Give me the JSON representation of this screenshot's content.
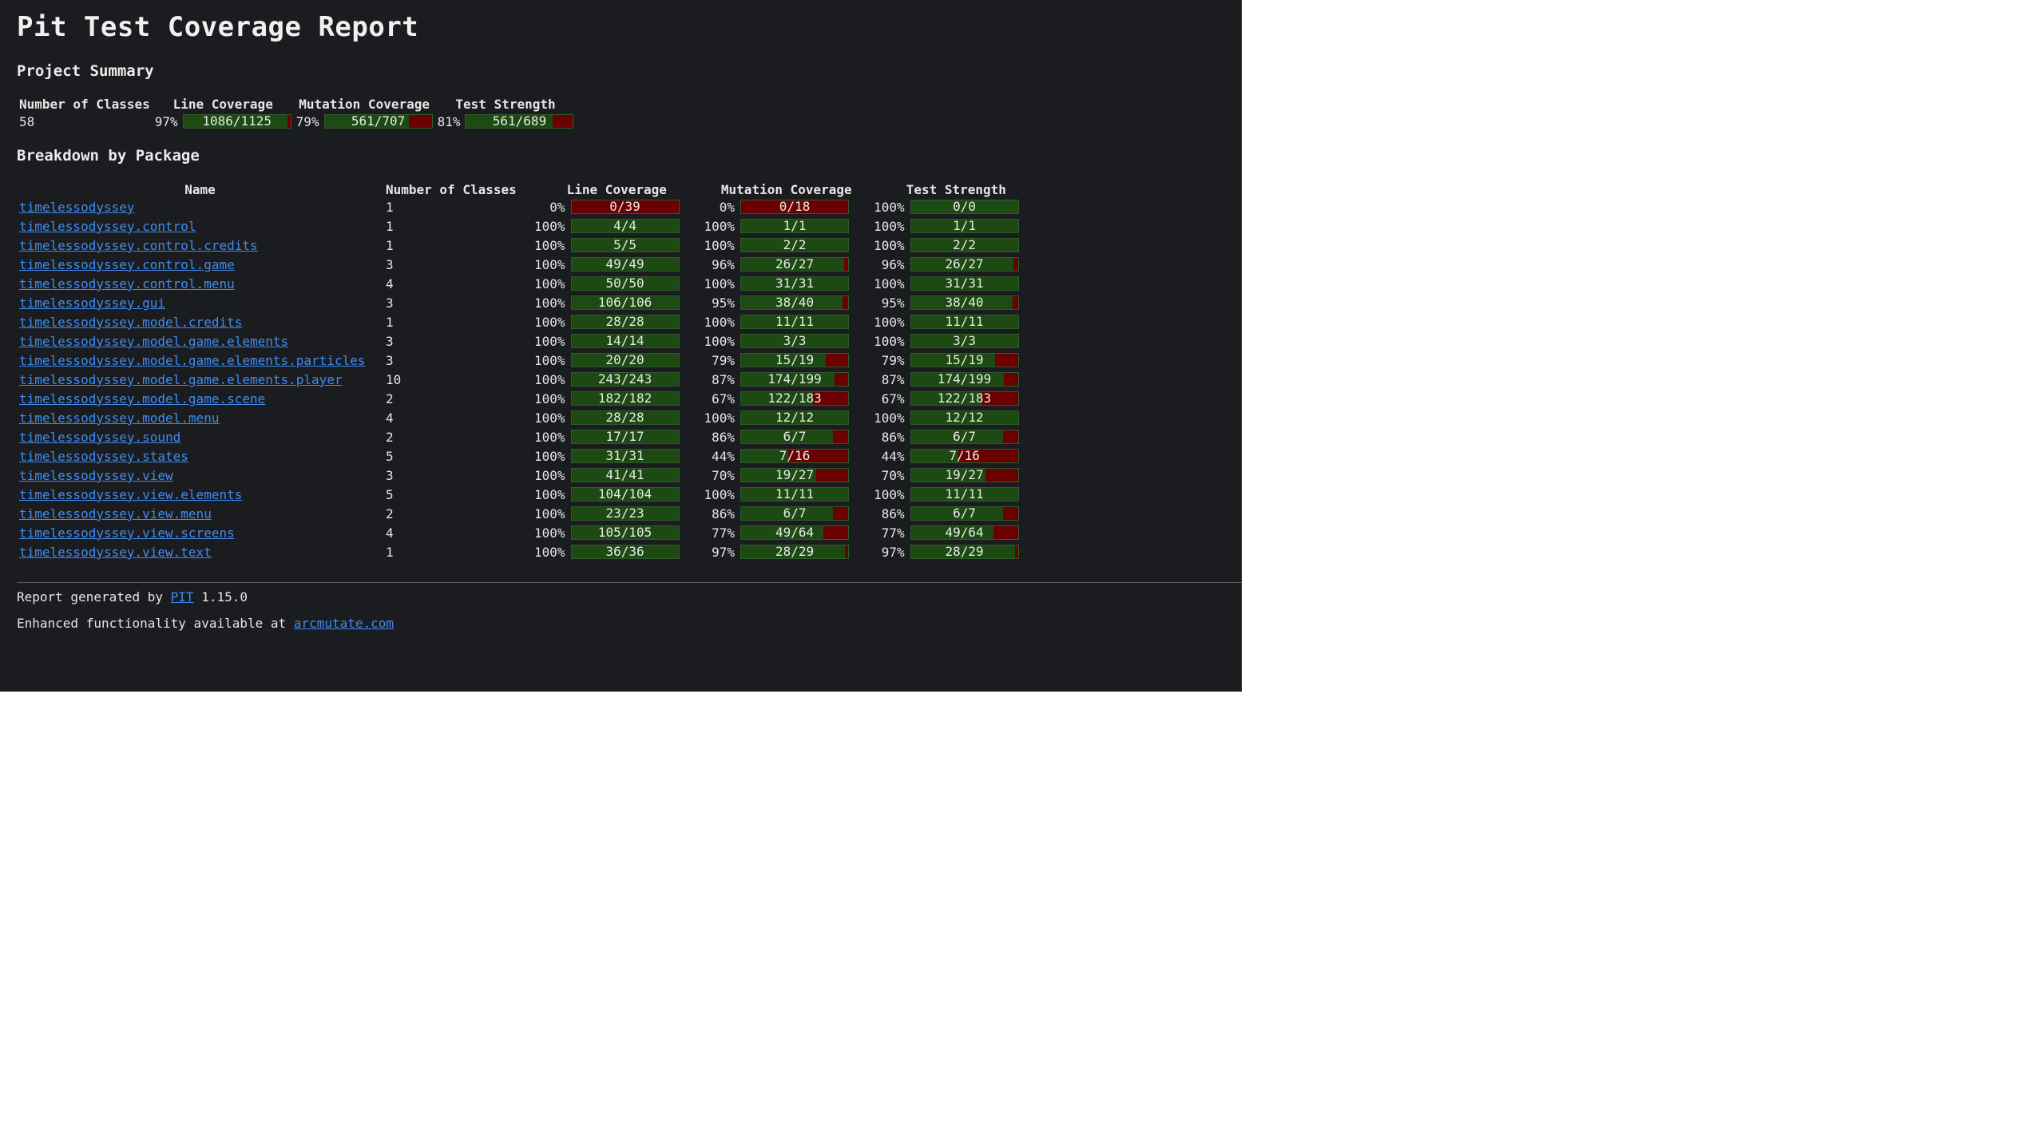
{
  "title": "Pit Test Coverage Report",
  "summary": {
    "heading": "Project Summary",
    "columns": [
      "Number of Classes",
      "Line Coverage",
      "Mutation Coverage",
      "Test Strength"
    ],
    "classes": "58",
    "line": {
      "pct": "97%",
      "label": "1086/1125",
      "fraction": 0.97
    },
    "mutation": {
      "pct": "79%",
      "label": "561/707",
      "fraction": 0.79
    },
    "strength": {
      "pct": "81%",
      "label": "561/689",
      "fraction": 0.81
    }
  },
  "breakdown": {
    "heading": "Breakdown by Package",
    "columns": [
      "Name",
      "Number of Classes",
      "Line Coverage",
      "Mutation Coverage",
      "Test Strength"
    ],
    "rows": [
      {
        "name": "timelessodyssey",
        "classes": "1",
        "line": {
          "pct": "0%",
          "label": "0/39",
          "fraction": 0
        },
        "mutation": {
          "pct": "0%",
          "label": "0/18",
          "fraction": 0
        },
        "strength": {
          "pct": "100%",
          "label": "0/0",
          "fraction": 1
        }
      },
      {
        "name": "timelessodyssey.control",
        "classes": "1",
        "line": {
          "pct": "100%",
          "label": "4/4",
          "fraction": 1
        },
        "mutation": {
          "pct": "100%",
          "label": "1/1",
          "fraction": 1
        },
        "strength": {
          "pct": "100%",
          "label": "1/1",
          "fraction": 1
        }
      },
      {
        "name": "timelessodyssey.control.credits",
        "classes": "1",
        "line": {
          "pct": "100%",
          "label": "5/5",
          "fraction": 1
        },
        "mutation": {
          "pct": "100%",
          "label": "2/2",
          "fraction": 1
        },
        "strength": {
          "pct": "100%",
          "label": "2/2",
          "fraction": 1
        }
      },
      {
        "name": "timelessodyssey.control.game",
        "classes": "3",
        "line": {
          "pct": "100%",
          "label": "49/49",
          "fraction": 1
        },
        "mutation": {
          "pct": "96%",
          "label": "26/27",
          "fraction": 0.96
        },
        "strength": {
          "pct": "96%",
          "label": "26/27",
          "fraction": 0.96
        }
      },
      {
        "name": "timelessodyssey.control.menu",
        "classes": "4",
        "line": {
          "pct": "100%",
          "label": "50/50",
          "fraction": 1
        },
        "mutation": {
          "pct": "100%",
          "label": "31/31",
          "fraction": 1
        },
        "strength": {
          "pct": "100%",
          "label": "31/31",
          "fraction": 1
        }
      },
      {
        "name": "timelessodyssey.gui",
        "classes": "3",
        "line": {
          "pct": "100%",
          "label": "106/106",
          "fraction": 1
        },
        "mutation": {
          "pct": "95%",
          "label": "38/40",
          "fraction": 0.95
        },
        "strength": {
          "pct": "95%",
          "label": "38/40",
          "fraction": 0.95
        }
      },
      {
        "name": "timelessodyssey.model.credits",
        "classes": "1",
        "line": {
          "pct": "100%",
          "label": "28/28",
          "fraction": 1
        },
        "mutation": {
          "pct": "100%",
          "label": "11/11",
          "fraction": 1
        },
        "strength": {
          "pct": "100%",
          "label": "11/11",
          "fraction": 1
        }
      },
      {
        "name": "timelessodyssey.model.game.elements",
        "classes": "3",
        "line": {
          "pct": "100%",
          "label": "14/14",
          "fraction": 1
        },
        "mutation": {
          "pct": "100%",
          "label": "3/3",
          "fraction": 1
        },
        "strength": {
          "pct": "100%",
          "label": "3/3",
          "fraction": 1
        }
      },
      {
        "name": "timelessodyssey.model.game.elements.particles",
        "classes": "3",
        "line": {
          "pct": "100%",
          "label": "20/20",
          "fraction": 1
        },
        "mutation": {
          "pct": "79%",
          "label": "15/19",
          "fraction": 0.79
        },
        "strength": {
          "pct": "79%",
          "label": "15/19",
          "fraction": 0.79
        }
      },
      {
        "name": "timelessodyssey.model.game.elements.player",
        "classes": "10",
        "line": {
          "pct": "100%",
          "label": "243/243",
          "fraction": 1
        },
        "mutation": {
          "pct": "87%",
          "label": "174/199",
          "fraction": 0.87
        },
        "strength": {
          "pct": "87%",
          "label": "174/199",
          "fraction": 0.87
        }
      },
      {
        "name": "timelessodyssey.model.game.scene",
        "classes": "2",
        "line": {
          "pct": "100%",
          "label": "182/182",
          "fraction": 1
        },
        "mutation": {
          "pct": "67%",
          "label": "122/183",
          "fraction": 0.67
        },
        "strength": {
          "pct": "67%",
          "label": "122/183",
          "fraction": 0.67
        }
      },
      {
        "name": "timelessodyssey.model.menu",
        "classes": "4",
        "line": {
          "pct": "100%",
          "label": "28/28",
          "fraction": 1
        },
        "mutation": {
          "pct": "100%",
          "label": "12/12",
          "fraction": 1
        },
        "strength": {
          "pct": "100%",
          "label": "12/12",
          "fraction": 1
        }
      },
      {
        "name": "timelessodyssey.sound",
        "classes": "2",
        "line": {
          "pct": "100%",
          "label": "17/17",
          "fraction": 1
        },
        "mutation": {
          "pct": "86%",
          "label": "6/7",
          "fraction": 0.86
        },
        "strength": {
          "pct": "86%",
          "label": "6/7",
          "fraction": 0.86
        }
      },
      {
        "name": "timelessodyssey.states",
        "classes": "5",
        "line": {
          "pct": "100%",
          "label": "31/31",
          "fraction": 1
        },
        "mutation": {
          "pct": "44%",
          "label": "7/16",
          "fraction": 0.44
        },
        "strength": {
          "pct": "44%",
          "label": "7/16",
          "fraction": 0.44
        }
      },
      {
        "name": "timelessodyssey.view",
        "classes": "3",
        "line": {
          "pct": "100%",
          "label": "41/41",
          "fraction": 1
        },
        "mutation": {
          "pct": "70%",
          "label": "19/27",
          "fraction": 0.7
        },
        "strength": {
          "pct": "70%",
          "label": "19/27",
          "fraction": 0.7
        }
      },
      {
        "name": "timelessodyssey.view.elements",
        "classes": "5",
        "line": {
          "pct": "100%",
          "label": "104/104",
          "fraction": 1
        },
        "mutation": {
          "pct": "100%",
          "label": "11/11",
          "fraction": 1
        },
        "strength": {
          "pct": "100%",
          "label": "11/11",
          "fraction": 1
        }
      },
      {
        "name": "timelessodyssey.view.menu",
        "classes": "2",
        "line": {
          "pct": "100%",
          "label": "23/23",
          "fraction": 1
        },
        "mutation": {
          "pct": "86%",
          "label": "6/7",
          "fraction": 0.86
        },
        "strength": {
          "pct": "86%",
          "label": "6/7",
          "fraction": 0.86
        }
      },
      {
        "name": "timelessodyssey.view.screens",
        "classes": "4",
        "line": {
          "pct": "100%",
          "label": "105/105",
          "fraction": 1
        },
        "mutation": {
          "pct": "77%",
          "label": "49/64",
          "fraction": 0.77
        },
        "strength": {
          "pct": "77%",
          "label": "49/64",
          "fraction": 0.77
        }
      },
      {
        "name": "timelessodyssey.view.text",
        "classes": "1",
        "line": {
          "pct": "100%",
          "label": "36/36",
          "fraction": 1
        },
        "mutation": {
          "pct": "97%",
          "label": "28/29",
          "fraction": 0.97
        },
        "strength": {
          "pct": "97%",
          "label": "28/29",
          "fraction": 0.97
        }
      }
    ]
  },
  "footer": {
    "generated_prefix": "Report generated by ",
    "generated_link": "PIT",
    "generated_version": " 1.15.0",
    "enhanced_prefix": "Enhanced functionality available at ",
    "enhanced_link": "arcmutate.com"
  },
  "colors": {
    "background": "#1b1c1f",
    "text": "#e6e6e6",
    "link": "#3f8cf0",
    "covered": "#1d4a12",
    "uncovered": "#6b0000"
  }
}
